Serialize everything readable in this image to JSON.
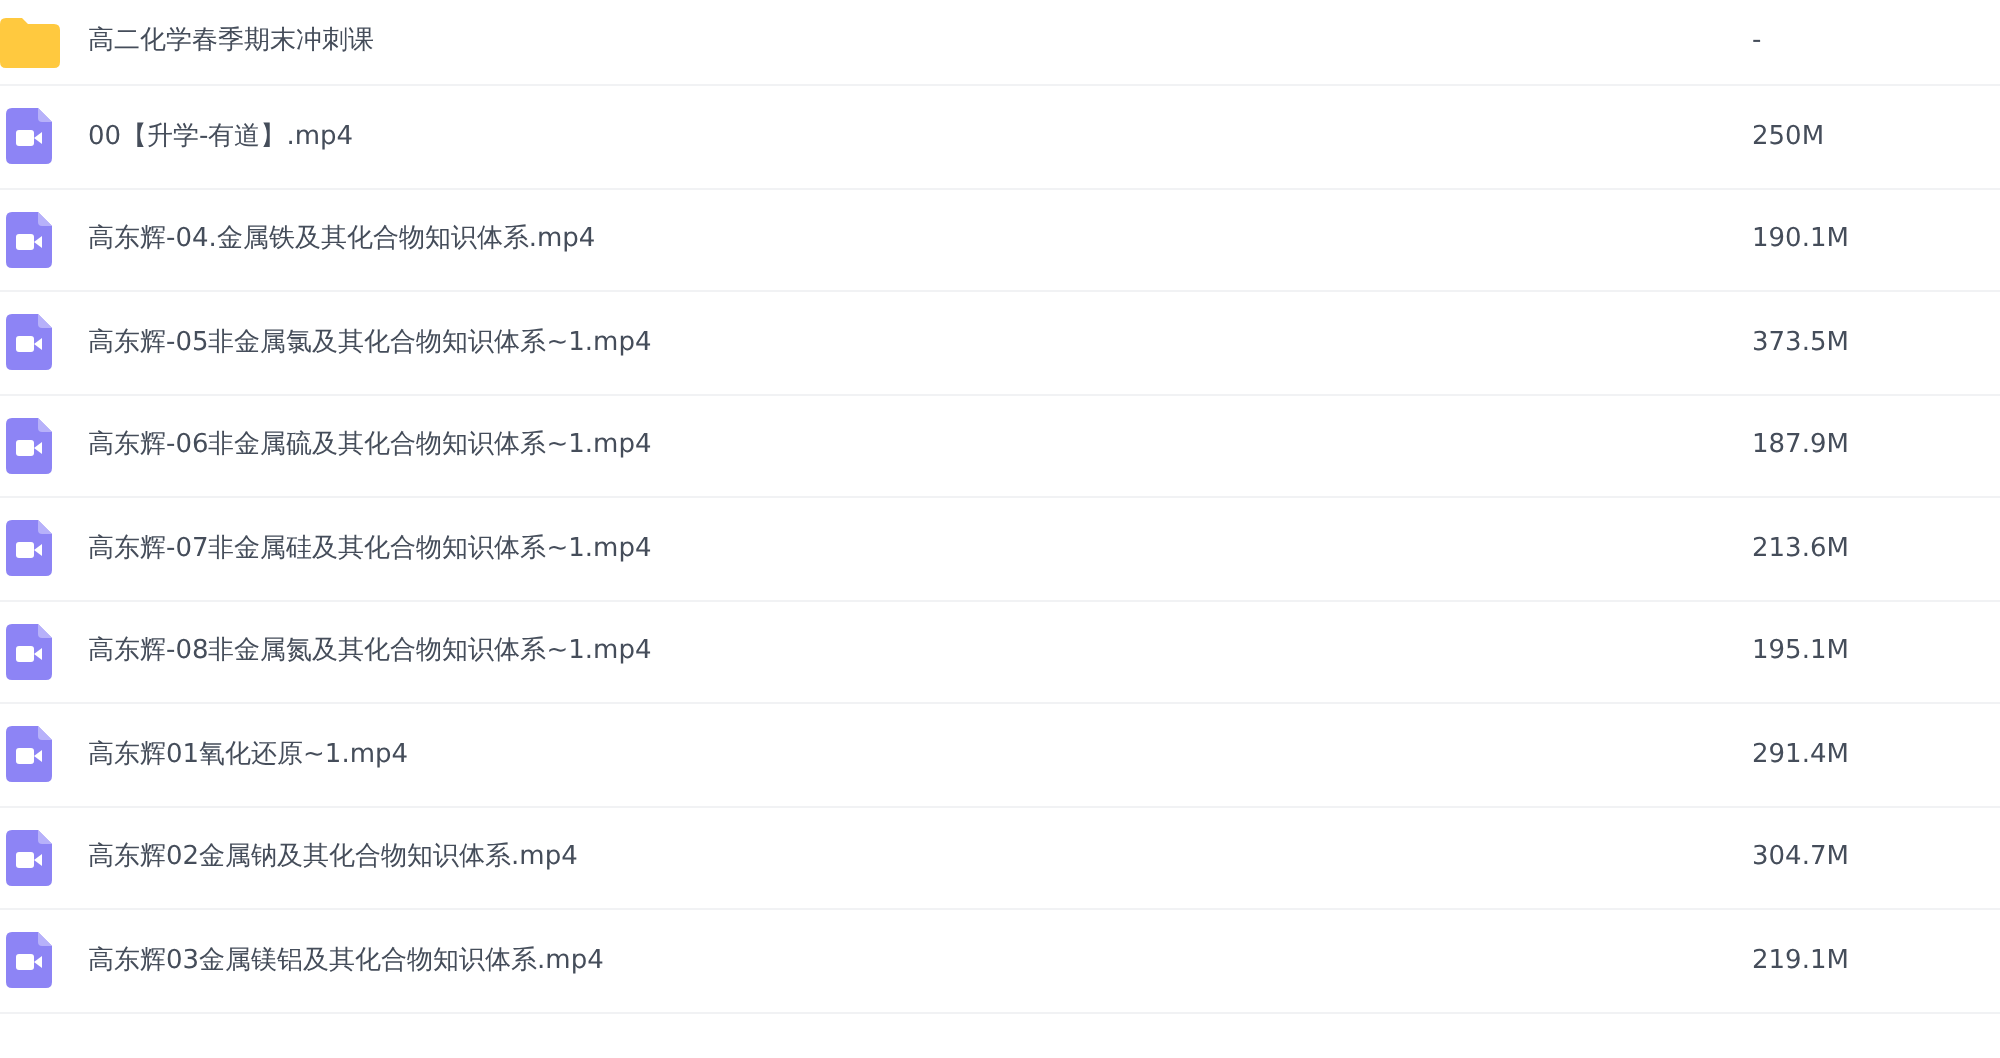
{
  "files": [
    {
      "kind": "folder",
      "name": "高二化学春季期末冲刺课",
      "size": "-"
    },
    {
      "kind": "video",
      "name": "00【升学-有道】.mp4",
      "size": "250M"
    },
    {
      "kind": "video",
      "name": "高东辉-04.金属铁及其化合物知识体系.mp4",
      "size": "190.1M"
    },
    {
      "kind": "video",
      "name": "高东辉-05非金属氯及其化合物知识体系~1.mp4",
      "size": "373.5M"
    },
    {
      "kind": "video",
      "name": "高东辉-06非金属硫及其化合物知识体系~1.mp4",
      "size": "187.9M"
    },
    {
      "kind": "video",
      "name": "高东辉-07非金属硅及其化合物知识体系~1.mp4",
      "size": "213.6M"
    },
    {
      "kind": "video",
      "name": "高东辉-08非金属氮及其化合物知识体系~1.mp4",
      "size": "195.1M"
    },
    {
      "kind": "video",
      "name": "高东辉01氧化还原~1.mp4",
      "size": "291.4M"
    },
    {
      "kind": "video",
      "name": "高东辉02金属钠及其化合物知识体系.mp4",
      "size": "304.7M"
    },
    {
      "kind": "video",
      "name": "高东辉03金属镁铝及其化合物知识体系.mp4",
      "size": "219.1M"
    }
  ]
}
